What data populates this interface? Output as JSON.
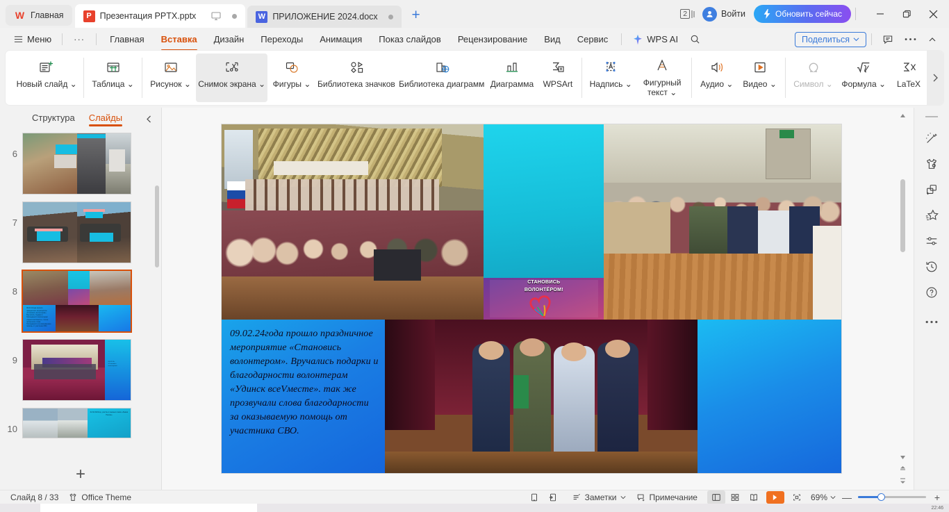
{
  "window": {
    "tabs": [
      {
        "label": "Главная",
        "icon": "wps-logo-icon",
        "type": "home"
      },
      {
        "label": "Презентация PPTX.pptx",
        "icon": "powerpoint-icon",
        "type": "active"
      },
      {
        "label": "ПРИЛОЖЕНИЕ 2024.docx",
        "icon": "word-icon",
        "type": "inactive"
      }
    ],
    "new_tab_label": "+",
    "window_count": "2",
    "signin_label": "Войти",
    "update_label": "Обновить сейчас",
    "minimize_label": "—",
    "restore_label": "❐",
    "close_label": "✕"
  },
  "menubar": {
    "menu_label": "Меню",
    "overflow_label": "···",
    "tabs": [
      {
        "label": "Главная",
        "active": false
      },
      {
        "label": "Вставка",
        "active": true
      },
      {
        "label": "Дизайн",
        "active": false
      },
      {
        "label": "Переходы",
        "active": false
      },
      {
        "label": "Анимация",
        "active": false
      },
      {
        "label": "Показ слайдов",
        "active": false
      },
      {
        "label": "Рецензирование",
        "active": false
      },
      {
        "label": "Вид",
        "active": false
      },
      {
        "label": "Сервис",
        "active": false
      }
    ],
    "wpsai_label": "WPS AI",
    "search_icon": "search-icon",
    "share_label": "Поделиться",
    "comment_icon": "comment-icon",
    "more_icon": "more-horizontal-icon"
  },
  "ribbon": {
    "buttons": [
      {
        "label": "Новый слайд",
        "icon": "new-slide-icon",
        "caret": true,
        "state": "normal"
      },
      {
        "label": "Таблица",
        "icon": "table-icon",
        "caret": true,
        "state": "normal",
        "sep_before": true
      },
      {
        "label": "Рисунок",
        "icon": "picture-icon",
        "caret": true,
        "state": "normal",
        "sep_before": true
      },
      {
        "label": "Снимок экрана",
        "icon": "screenshot-icon",
        "caret": true,
        "state": "selected"
      },
      {
        "label": "Фигуры",
        "icon": "shapes-icon",
        "caret": true,
        "state": "normal"
      },
      {
        "label": "Библиотека значков",
        "icon": "icon-library-icon",
        "caret": false,
        "state": "normal"
      },
      {
        "label": "Библиотека диаграмм",
        "icon": "chart-library-icon",
        "caret": false,
        "state": "normal"
      },
      {
        "label": "Диаграмма",
        "icon": "chart-icon",
        "caret": false,
        "state": "normal"
      },
      {
        "label": "WPSArt",
        "icon": "wpsart-icon",
        "caret": false,
        "state": "normal"
      },
      {
        "label": "Надпись",
        "icon": "textbox-icon",
        "caret": true,
        "state": "normal",
        "sep_before": true
      },
      {
        "label": "Фигурный текст",
        "icon": "wordart-icon",
        "caret": true,
        "state": "normal",
        "two_line": true
      },
      {
        "label": "Аудио",
        "icon": "audio-icon",
        "caret": true,
        "state": "normal",
        "sep_before": true
      },
      {
        "label": "Видео",
        "icon": "video-icon",
        "caret": true,
        "state": "normal"
      },
      {
        "label": "Символ",
        "icon": "symbol-omega-icon",
        "caret": true,
        "state": "disabled",
        "sep_before": true
      },
      {
        "label": "Формула",
        "icon": "formula-icon",
        "caret": true,
        "state": "normal"
      },
      {
        "label": "LaTeX",
        "icon": "latex-icon",
        "caret": false,
        "state": "normal"
      }
    ],
    "expand_icon": "chevron-right-icon"
  },
  "slide_panel": {
    "tabs": [
      {
        "label": "Структура",
        "active": false
      },
      {
        "label": "Слайды",
        "active": true
      }
    ],
    "collapse_icon": "chevron-left-icon",
    "thumbnails": [
      {
        "number": "6",
        "selected": false
      },
      {
        "number": "7",
        "selected": false
      },
      {
        "number": "8",
        "selected": true
      },
      {
        "number": "9",
        "selected": false
      },
      {
        "number": "10",
        "selected": false
      }
    ],
    "add_slide_label": "+"
  },
  "slide": {
    "caption_text": "09.02.24года прошло праздничное мероприятие «Становись волонтером». Вручались подарки и благодарности  волонтерам «Удинск всеVместе». так же прозвучали слова благодарности за оказываемую помощь от  участника СВО.",
    "banner_line1": "СТАНОВИСЬ",
    "banner_line2": "ВОЛОНТЁРОМ!",
    "accent_cyan": "#1ec8e0",
    "accent_blue": "#1878e6"
  },
  "rail": {
    "items": [
      {
        "icon": "magic-wand-icon",
        "name": "design-ideas"
      },
      {
        "icon": "tshirt-theme-icon",
        "name": "theme-settings"
      },
      {
        "icon": "shapes-align-icon",
        "name": "object-properties"
      },
      {
        "icon": "star-favorites-icon",
        "name": "favorites"
      },
      {
        "icon": "sliders-icon",
        "name": "adjust-settings"
      },
      {
        "icon": "history-clock-icon",
        "name": "version-history"
      },
      {
        "icon": "help-question-icon",
        "name": "help"
      },
      {
        "icon": "more-dots-icon",
        "name": "more-tools"
      }
    ]
  },
  "statusbar": {
    "slide_counter": "Слайд 8 / 33",
    "theme_label": "Office Theme",
    "theme_icon": "theme-icon",
    "fit_icon": "fit-slide-icon",
    "export_icon": "export-icon",
    "notes_label": "Заметки",
    "comment_label": "Примечание",
    "views": [
      {
        "icon": "normal-view-icon",
        "active": true
      },
      {
        "icon": "slide-sorter-icon",
        "active": false
      },
      {
        "icon": "reading-view-icon",
        "active": false
      }
    ],
    "play_icon": "play-icon",
    "fullscreen_icon": "fullscreen-icon",
    "zoom_level": "69%",
    "zoom_out_label": "—",
    "zoom_in_label": "+"
  },
  "taskbar": {
    "time": "22:46"
  }
}
